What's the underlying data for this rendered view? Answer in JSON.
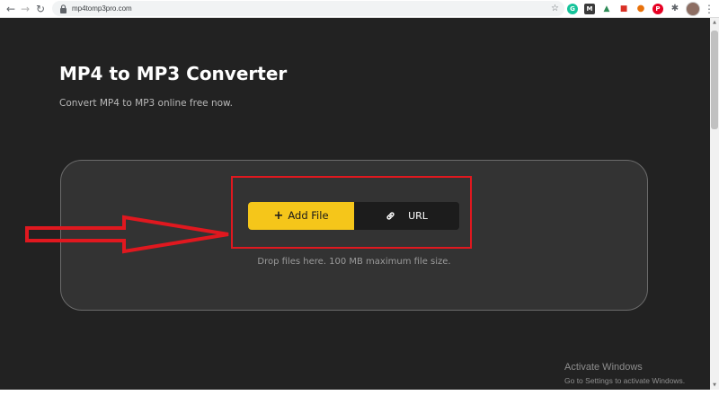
{
  "browser": {
    "url": "mp4tomp3pro.com",
    "back_icon": "←",
    "forward_icon": "→",
    "reload_icon": "↻",
    "bookmark_icon": "☆",
    "menu_icon": "⋮",
    "extensions": [
      {
        "name": "grammarly-extension-icon",
        "glyph": "G",
        "color": "#15c39a"
      },
      {
        "name": "m-extension-icon",
        "glyph": "M",
        "color": "#3a3a3a"
      },
      {
        "name": "green-extension-icon",
        "glyph": "▲",
        "color": "#2e8b57"
      },
      {
        "name": "red-extension-icon",
        "glyph": "■",
        "color": "#d93025"
      },
      {
        "name": "orange-extension-icon",
        "glyph": "●",
        "color": "#e8710a"
      },
      {
        "name": "pinterest-extension-icon",
        "glyph": "P",
        "color": "#e60023"
      },
      {
        "name": "puzzle-extensions-icon",
        "glyph": "✱",
        "color": "#5f6368"
      }
    ]
  },
  "page": {
    "title": "MP4 to MP3 Converter",
    "subtitle": "Convert MP4 to MP3 online free now.",
    "add_file_label": "Add File",
    "add_file_icon": "+",
    "url_label": "URL",
    "drop_hint": "Drop files here. 100 MB maximum file size."
  },
  "overlay": {
    "activate_title": "Activate Windows",
    "activate_subtitle": "Go to Settings to activate Windows."
  },
  "colors": {
    "background": "#222222",
    "dropzone": "#333333",
    "accent_yellow": "#f5c61a",
    "annotation_red": "#e0181f"
  }
}
